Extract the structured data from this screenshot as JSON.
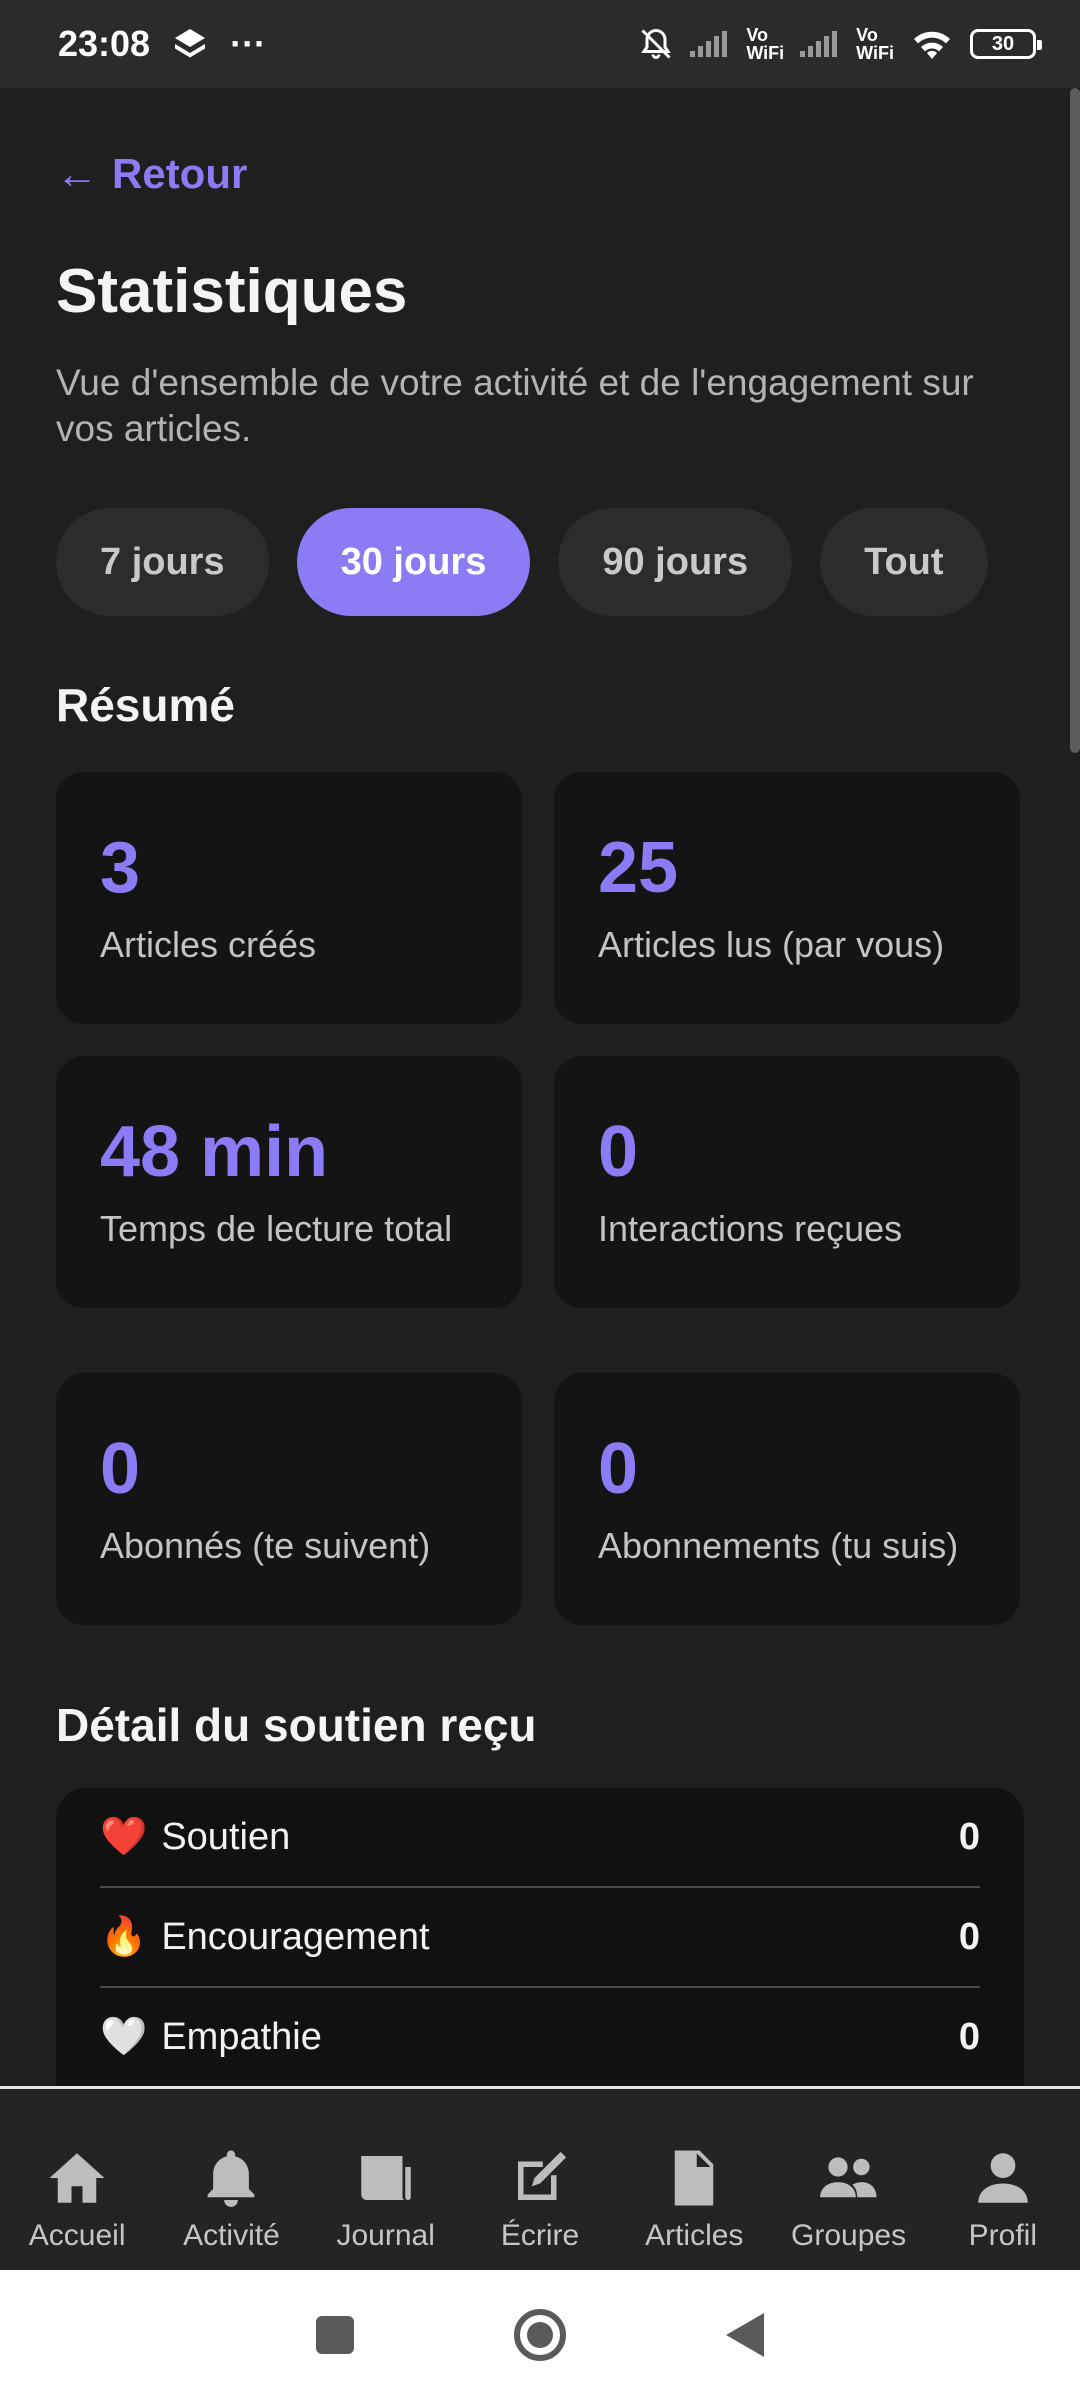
{
  "status_bar": {
    "time": "23:08",
    "dots": "···",
    "vo_wifi_1": "Vo\nWiFi",
    "vo_wifi_2": "Vo\nWiFi",
    "battery": "30"
  },
  "header": {
    "back_label": "Retour",
    "title": "Statistiques",
    "subtitle": "Vue d'ensemble de votre activité et de l'engagement sur vos articles."
  },
  "filters": [
    {
      "label": "7 jours",
      "active": false
    },
    {
      "label": "30 jours",
      "active": true
    },
    {
      "label": "90 jours",
      "active": false
    },
    {
      "label": "Tout",
      "active": false
    }
  ],
  "summary": {
    "title": "Résumé",
    "cards": [
      {
        "value": "3",
        "label": "Articles créés"
      },
      {
        "value": "25",
        "label": "Articles lus (par vous)"
      },
      {
        "value": "48 min",
        "label": "Temps de lecture total"
      },
      {
        "value": "0",
        "label": "Interactions reçues"
      },
      {
        "value": "0",
        "label": "Abonnés (te suivent)"
      },
      {
        "value": "0",
        "label": "Abonnements (tu suis)"
      }
    ]
  },
  "support": {
    "title": "Détail du soutien reçu",
    "rows": [
      {
        "emoji": "❤️",
        "label": "Soutien",
        "count": "0"
      },
      {
        "emoji": "🔥",
        "label": "Encouragement",
        "count": "0"
      },
      {
        "emoji": "🤍",
        "label": "Empathie",
        "count": "0"
      }
    ]
  },
  "bottom_nav": [
    {
      "label": "Accueil",
      "icon": "home-icon"
    },
    {
      "label": "Activité",
      "icon": "bell-icon"
    },
    {
      "label": "Journal",
      "icon": "newspaper-icon"
    },
    {
      "label": "Écrire",
      "icon": "edit-icon"
    },
    {
      "label": "Articles",
      "icon": "document-icon"
    },
    {
      "label": "Groupes",
      "icon": "group-icon"
    },
    {
      "label": "Profil",
      "icon": "user-icon"
    }
  ],
  "colors": {
    "accent": "#8b7cf6",
    "background": "#1f1f1f",
    "card": "#141414"
  }
}
